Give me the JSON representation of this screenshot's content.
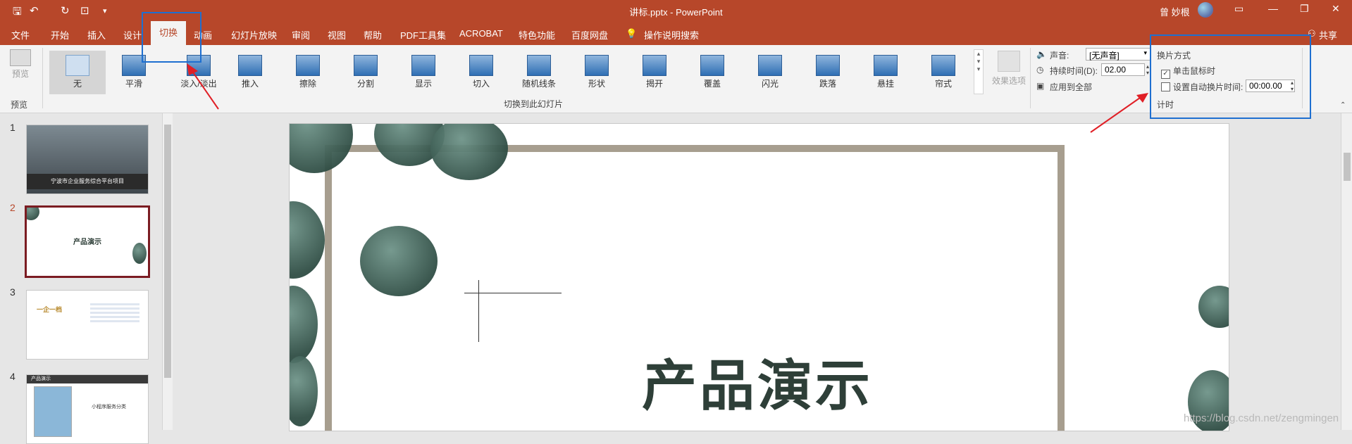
{
  "titlebar": {
    "title": "讲标.pptx  -  PowerPoint",
    "user": "曾 妙根",
    "qa_save": "🖫",
    "qa_undo": "↶",
    "qa_redo": "↻",
    "qa_touch": "⊡",
    "qa_custom": "▾",
    "win_opts": "▭",
    "win_min": "—",
    "win_restore": "❐",
    "win_close": "✕"
  },
  "menu": {
    "tabs": [
      "文件",
      "开始",
      "插入",
      "设计",
      "切换",
      "动画",
      "幻灯片放映",
      "审阅",
      "视图",
      "帮助",
      "PDF工具集",
      "ACROBAT",
      "特色功能",
      "百度网盘"
    ],
    "tell_me": "操作说明搜索",
    "share": "共享"
  },
  "ribbon": {
    "preview_label": "预览",
    "preview_group": "预览",
    "transitions": [
      "无",
      "平滑",
      "淡入/淡出",
      "推入",
      "擦除",
      "分割",
      "显示",
      "切入",
      "随机线条",
      "形状",
      "揭开",
      "覆盖",
      "闪光",
      "跌落",
      "悬挂",
      "帘式"
    ],
    "effect_options": "效果选项",
    "group_label": "切换到此幻灯片",
    "sound_label": "声音:",
    "sound_value": "[无声音]",
    "duration_label": "持续时间(D):",
    "duration_value": "02.00",
    "apply_all": "应用到全部",
    "advance_title": "换片方式",
    "on_click": "单击鼠标时",
    "after_time": "设置自动换片时间:",
    "after_value": "00:00.00",
    "timing_group": "计时"
  },
  "slides": {
    "numbers": [
      "1",
      "2",
      "3",
      "4"
    ],
    "thumb1_caption": "宁波市企业服务综合平台项目",
    "thumb2_title": "产品演示",
    "thumb3_title": "一企一档",
    "thumb4_header": "产品演示",
    "thumb4_sub": "小程序服务分类"
  },
  "main_slide": {
    "title": "产品演示"
  },
  "watermark": "https://blog.csdn.net/zengmingen",
  "colors": {
    "accent": "#b7472a",
    "annotation_box": "#1e6fd0",
    "annotation_arrow": "#e01f26"
  }
}
